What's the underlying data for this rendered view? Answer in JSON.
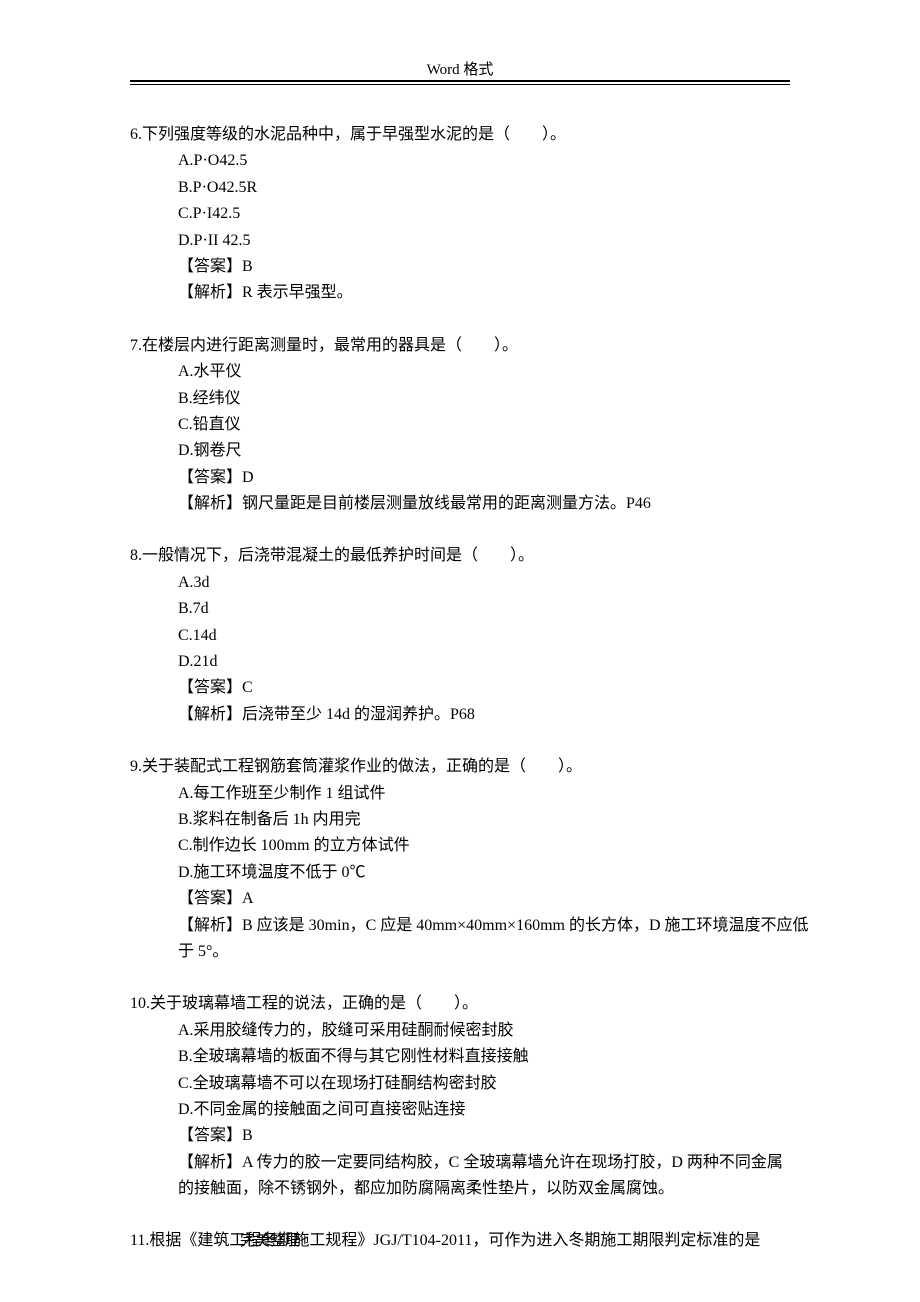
{
  "header": "Word 格式",
  "footer": "完美整理",
  "questions": [
    {
      "num": "6.",
      "stem": "下列强度等级的水泥品种中，属于早强型水泥的是（　　）。",
      "opts": [
        "A.P·O42.5",
        "B.P·O42.5R",
        "C.P·I42.5",
        "D.P·II 42.5"
      ],
      "ans": "【答案】B",
      "exp": "【解析】R 表示早强型。"
    },
    {
      "num": "7.",
      "stem": "在楼层内进行距离测量时，最常用的器具是（　　）。",
      "opts": [
        "A.水平仪",
        "B.经纬仪",
        "C.铅直仪",
        "D.钢卷尺"
      ],
      "ans": "【答案】D",
      "exp": "【解析】钢尺量距是目前楼层测量放线最常用的距离测量方法。P46"
    },
    {
      "num": "8.",
      "stem": "一般情况下，后浇带混凝土的最低养护时间是（　　）。",
      "opts": [
        "A.3d",
        "B.7d",
        "C.14d",
        "D.21d"
      ],
      "ans": "【答案】C",
      "exp": "【解析】后浇带至少 14d 的湿润养护。P68"
    },
    {
      "num": "9.",
      "stem": "关于装配式工程钢筋套筒灌浆作业的做法，正确的是（　　）。",
      "opts": [
        "A.每工作班至少制作 1 组试件",
        "B.浆料在制备后 1h 内用完",
        "C.制作边长 100mm 的立方体试件",
        "D.施工环境温度不低于 0℃"
      ],
      "ans": "【答案】A",
      "exp": "【解析】B 应该是 30min，C 应是 40mm×40mm×160mm 的长方体，D 施工环境温度不应低",
      "exp2": "于 5°。"
    },
    {
      "num": "10.",
      "stem": "关于玻璃幕墙工程的说法，正确的是（　　）。",
      "opts": [
        "A.采用胶缝传力的，胶缝可采用硅酮耐候密封胶",
        "B.全玻璃幕墙的板面不得与其它刚性材料直接接触",
        "C.全玻璃幕墙不可以在现场打硅酮结构密封胶",
        "D.不同金属的接触面之间可直接密贴连接"
      ],
      "ans": "【答案】B",
      "exp": "【解析】A 传力的胶一定要同结构胶，C 全玻璃幕墙允许在现场打胶，D 两种不同金属",
      "exp2": "的接触面，除不锈钢外，都应加防腐隔离柔性垫片，以防双金属腐蚀。"
    },
    {
      "num": "11.",
      "stem": "根据《建筑工程冬期施工规程》JGJ/T104-2011，可作为进入冬期施工期限判定标准的是"
    }
  ]
}
